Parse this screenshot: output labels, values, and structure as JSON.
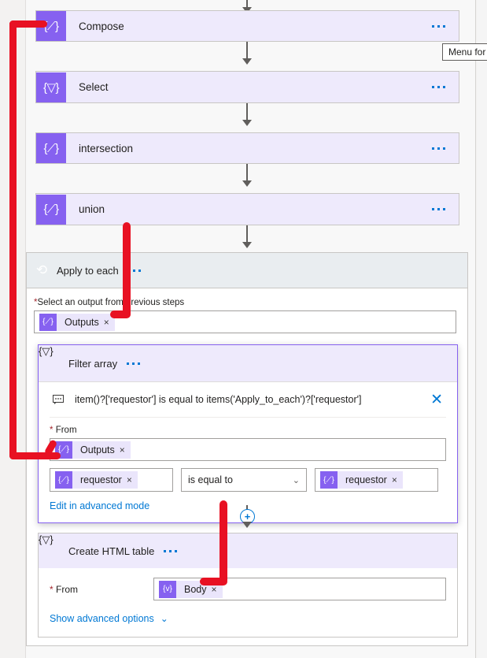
{
  "app": "power-automate-flow-designer",
  "colors": {
    "action_purple": "#8661f0",
    "action_card_bg": "#eeeafc",
    "scope_header_bg": "#e9edf0",
    "scope_icon_bg": "#6e7f91",
    "link_blue": "#0078d4",
    "required_red": "#a4262c",
    "annotation_red": "#e81123",
    "connector_gray": "#605e5c"
  },
  "flow": {
    "steps": [
      {
        "id": "compose",
        "title": "Compose",
        "icon": "compose-icon",
        "icon_glyph": "{⟋}",
        "menu_label": "..."
      },
      {
        "id": "select",
        "title": "Select",
        "icon": "select-icon",
        "icon_glyph": "{▽}",
        "menu_label": "..."
      },
      {
        "id": "intersection",
        "title": "intersection",
        "icon": "compose-icon",
        "icon_glyph": "{⟋}",
        "menu_label": "..."
      },
      {
        "id": "union",
        "title": "union",
        "icon": "compose-icon",
        "icon_glyph": "{⟋}",
        "menu_label": "..."
      }
    ]
  },
  "apply_to_each": {
    "title": "Apply to each",
    "icon_glyph": "⟲",
    "menu_label": "...",
    "output_field": {
      "label_required_mark": "*",
      "label": "Select an output from previous steps",
      "token": {
        "text": "Outputs",
        "glyph": "{⟋}",
        "remove": "×"
      }
    }
  },
  "filter_array": {
    "title": "Filter array",
    "icon_glyph": "{▽}",
    "menu_label": "...",
    "expression": {
      "icon": "comment-icon",
      "text": "item()?['requestor'] is equal to items('Apply_to_each')?['requestor']",
      "close": "✕"
    },
    "from": {
      "label_required_mark": "*",
      "label": "From",
      "token": {
        "text": "Outputs",
        "glyph": "{⟋}",
        "remove": "×"
      }
    },
    "condition": {
      "left_token": {
        "text": "requestor",
        "glyph": "{⟋}",
        "remove": "×"
      },
      "operator": "is equal to",
      "operator_chevron": "⌄",
      "right_token": {
        "text": "requestor",
        "glyph": "{⟋}",
        "remove": "×"
      }
    },
    "advanced_link": "Edit in advanced mode"
  },
  "create_html_table": {
    "title": "Create HTML table",
    "icon_glyph": "{▽}",
    "menu_label": "...",
    "from": {
      "label_required_mark": "*",
      "label": "From",
      "token": {
        "text": "Body",
        "glyph": "{v}",
        "remove": "×"
      }
    },
    "advanced_options": "Show advanced options",
    "advanced_chevron": "⌄"
  },
  "insert_node": {
    "plus": "+"
  },
  "tooltip": {
    "text": "Menu for"
  }
}
